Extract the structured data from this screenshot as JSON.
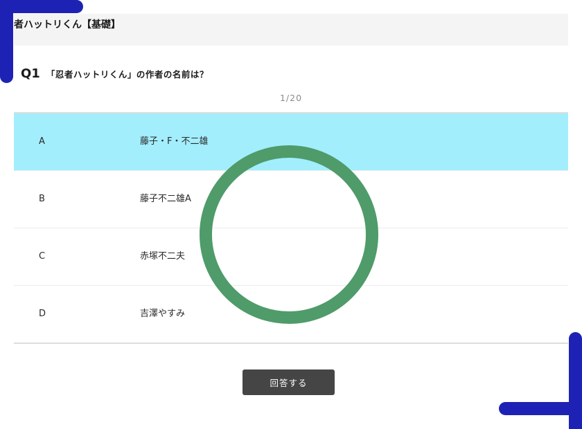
{
  "quiz": {
    "title": "者ハットリくん【基礎】",
    "question_number": "Q1",
    "question_text": "「忍者ハットリくん」の作者の名前は？",
    "progress": "1/20"
  },
  "choices": [
    {
      "letter": "A",
      "text": "藤子・F・不二雄",
      "selected": true
    },
    {
      "letter": "B",
      "text": "藤子不二雄A",
      "selected": false
    },
    {
      "letter": "C",
      "text": "赤塚不二夫",
      "selected": false
    },
    {
      "letter": "D",
      "text": "吉澤やすみ",
      "selected": false
    }
  ],
  "answer_button": {
    "label": "回答する"
  },
  "colors": {
    "selected_background": "#a3eefc",
    "loading_ring": "#4f9b6a",
    "corner_brackets": "#1e22b4",
    "button_background": "#454545"
  },
  "icons": {
    "loading": "loading-ring-icon",
    "corners": "corner-bracket-icon"
  }
}
